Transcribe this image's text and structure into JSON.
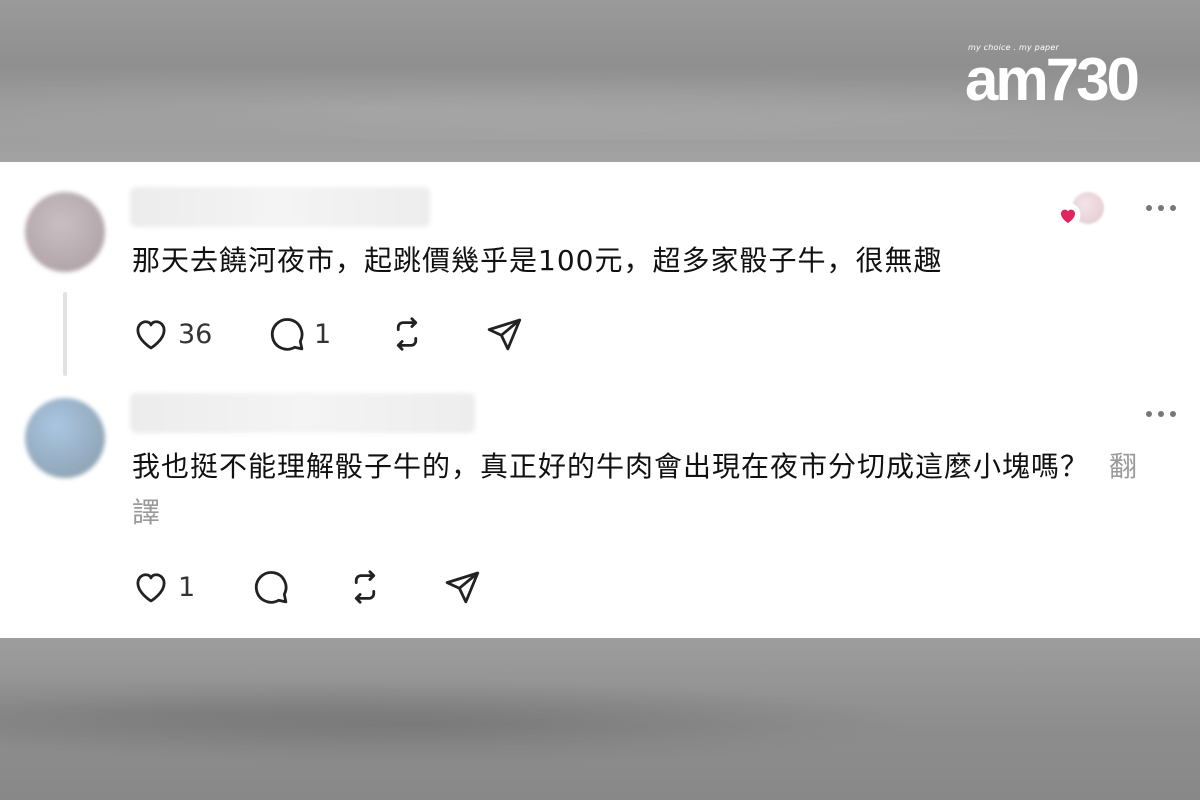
{
  "logo": {
    "tagline": "my choice . my paper",
    "mark": "am730"
  },
  "comments": [
    {
      "text": "那天去饒河夜市，起跳價幾乎是100元，超多家骰子牛，很無趣",
      "likes": "36",
      "replies": "1"
    },
    {
      "text": "我也挺不能理解骰子牛的，真正好的牛肉會出現在夜市分切成這麼小塊嗎？",
      "translate": "翻譯",
      "likes": "1"
    }
  ],
  "icons": {
    "like": "heart-outline-icon",
    "reply": "speech-bubble-icon",
    "repost": "repost-icon",
    "share": "paper-plane-icon",
    "more": "more-dots-icon",
    "liked": "red-heart-icon"
  },
  "colors": {
    "liked_heart": "#e0245e",
    "text": "#111111",
    "muted": "#9a9a9a"
  }
}
